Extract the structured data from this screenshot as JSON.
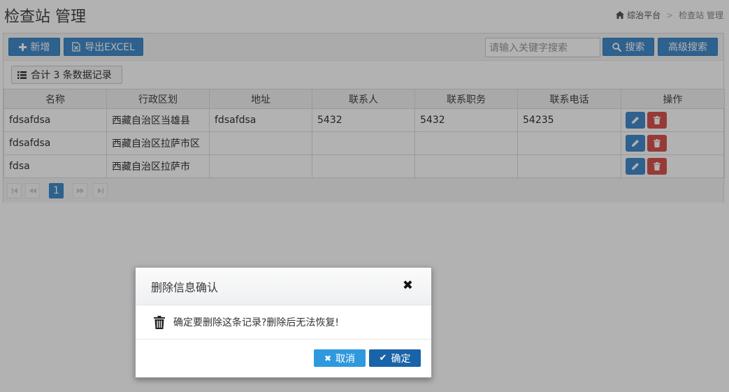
{
  "header": {
    "title": "检查站 管理",
    "breadcrumb": {
      "home": "综治平台",
      "separator": ">",
      "current": "检查站 管理"
    }
  },
  "toolbar": {
    "add_label": "新增",
    "export_label": "导出EXCEL",
    "search_placeholder": "请输入关键字搜索",
    "search_label": "搜索",
    "advanced_label": "高级搜索"
  },
  "summary": "合计 3 条数据记录",
  "table": {
    "columns": [
      "名称",
      "行政区划",
      "地址",
      "联系人",
      "联系职务",
      "联系电话",
      "操作"
    ],
    "rows": [
      [
        "fdsafdsa",
        "西藏自治区当雄县",
        "fdsafdsa",
        "5432",
        "5432",
        "54235"
      ],
      [
        "fdsafdsa",
        "西藏自治区拉萨市区",
        "",
        "",
        "",
        ""
      ],
      [
        "fdsa",
        "西藏自治区拉萨市",
        "",
        "",
        "",
        ""
      ]
    ]
  },
  "pager": {
    "current_page": "1"
  },
  "modal": {
    "title": "删除信息确认",
    "message": "确定要删除这条记录?删除后无法恢复!",
    "cancel_label": "取消",
    "ok_label": "确定"
  },
  "colors": {
    "primary": "#428bca",
    "danger": "#d9534f",
    "modal_cancel": "#2f99de",
    "modal_ok": "#1963a8"
  }
}
